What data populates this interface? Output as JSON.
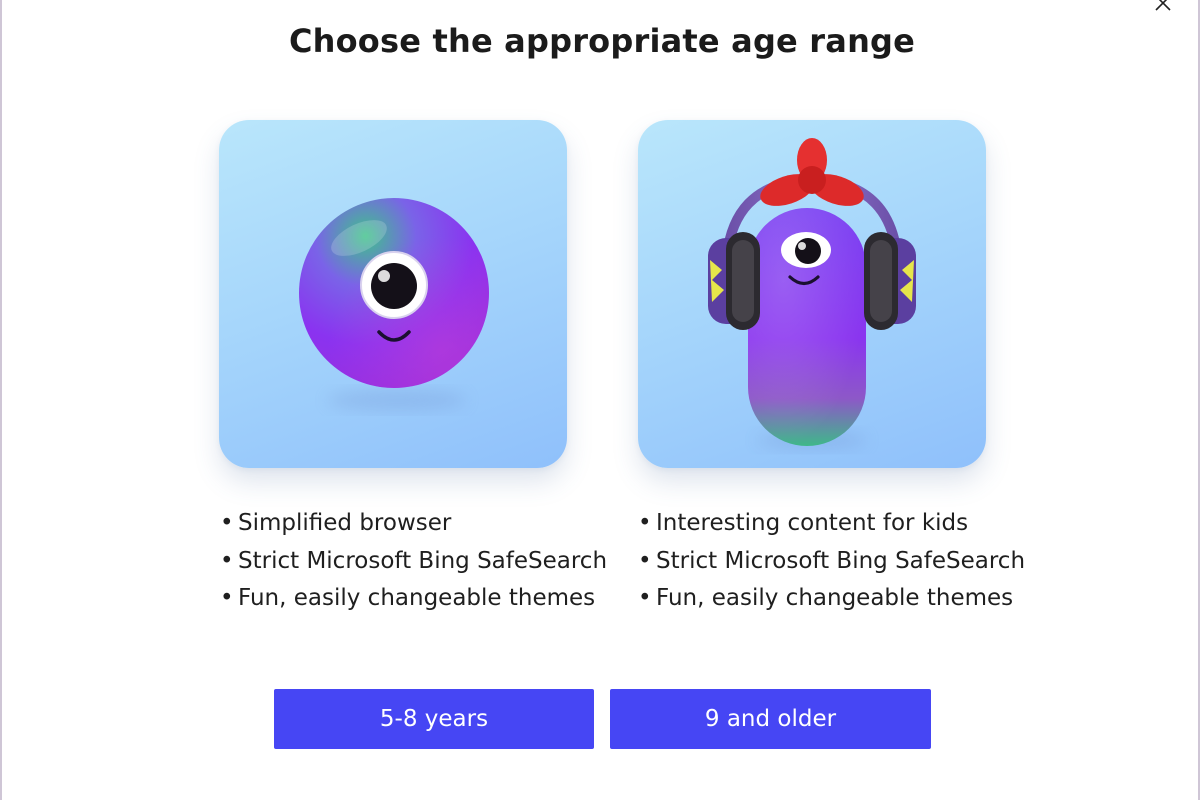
{
  "dialog": {
    "title": "Choose the appropriate age range"
  },
  "options": [
    {
      "illustration": "one-eyed-round-purple-character",
      "features": [
        "Simplified browser",
        "Strict Microsoft Bing SafeSearch",
        "Fun, easily changeable themes"
      ],
      "button_label": "5-8 years"
    },
    {
      "illustration": "one-eyed-capsule-character-with-headphones",
      "features": [
        "Interesting content for kids",
        "Strict Microsoft Bing SafeSearch",
        "Fun, easily changeable themes"
      ],
      "button_label": "9 and older"
    }
  ],
  "bullet": "•",
  "icons": {
    "close": "close-icon"
  },
  "colors": {
    "button": "#4646f4",
    "button_text": "#ffffff",
    "card_top": "#b9e6fb",
    "card_bottom": "#8fc0fb",
    "character_purple": "#7b3cf0",
    "character_green": "#3fb38a",
    "bow_red": "#e02a2a"
  }
}
